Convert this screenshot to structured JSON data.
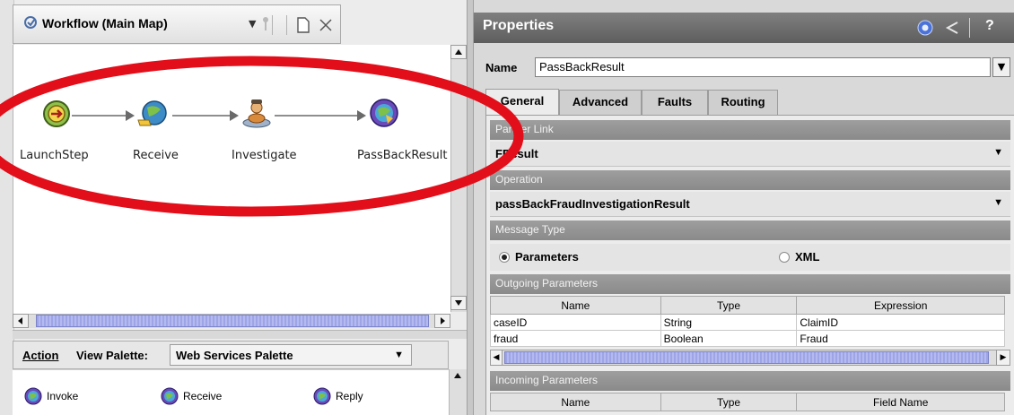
{
  "colors": {
    "highlight_ellipse": "#e20e1a",
    "scroll_thumb": "#a9afea",
    "properties_titlebar": "#6e6e6e"
  },
  "workflow": {
    "title": "Workflow (Main Map)",
    "nodes": [
      {
        "label": "LaunchStep",
        "icon": "launch-step-icon"
      },
      {
        "label": "Receive",
        "icon": "receive-node-icon"
      },
      {
        "label": "Investigate",
        "icon": "investigate-node-icon"
      },
      {
        "label": "PassBackResult",
        "icon": "pass-back-result-icon"
      }
    ]
  },
  "palette": {
    "action_label": "Action",
    "view_palette_label": "View Palette:",
    "selected_palette": "Web Services Palette",
    "items": [
      {
        "label": "Invoke",
        "icon": "invoke-icon"
      },
      {
        "label": "Receive",
        "icon": "receive-icon"
      },
      {
        "label": "Reply",
        "icon": "reply-icon"
      }
    ]
  },
  "properties": {
    "title": "Properties",
    "name_label": "Name",
    "name_value": "PassBackResult",
    "tabs": [
      "General",
      "Advanced",
      "Faults",
      "Routing"
    ],
    "active_tab": "General",
    "partner_link_header": "Partner Link",
    "partner_link_value": "FResult",
    "operation_header": "Operation",
    "operation_value": "passBackFraudInvestigationResult",
    "message_type_header": "Message Type",
    "message_type_options": [
      "Parameters",
      "XML"
    ],
    "selected_message_type": "Parameters",
    "outgoing_header": "Outgoing Parameters",
    "outgoing_columns": [
      "Name",
      "Type",
      "Expression"
    ],
    "outgoing_rows": [
      [
        "caseID",
        "String",
        "ClaimID"
      ],
      [
        "fraud",
        "Boolean",
        "Fraud"
      ]
    ],
    "incoming_header": "Incoming Parameters",
    "incoming_columns": [
      "Name",
      "Type",
      "Field Name"
    ]
  }
}
